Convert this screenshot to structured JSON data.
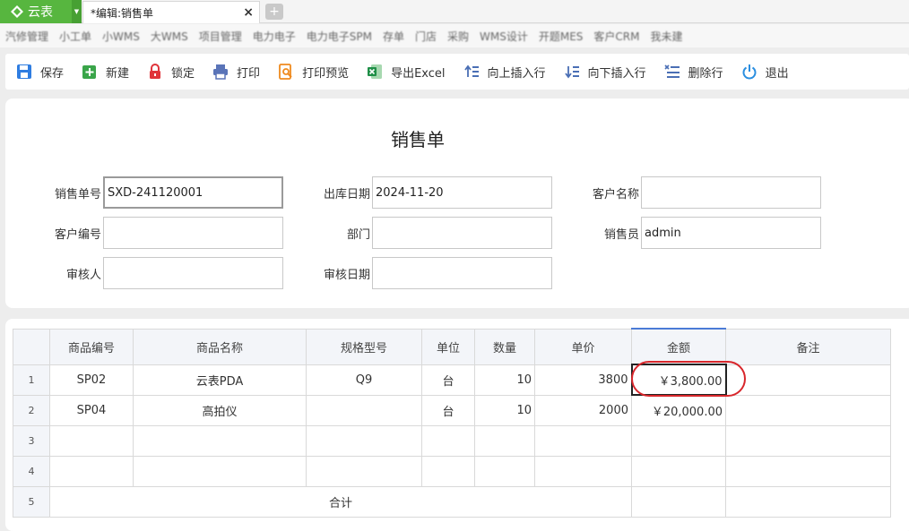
{
  "app": {
    "name": "云表"
  },
  "doc_tab": {
    "title": "*编辑:销售单"
  },
  "bookmarks": [
    "汽修管理",
    "小工单",
    "小WMS",
    "大WMS",
    "项目管理",
    "电力电子",
    "电力电子SPM",
    "存单",
    "门店",
    "采购",
    "WMS设计",
    "开题MES",
    "客户CRM",
    "我未建"
  ],
  "toolbar": {
    "save": "保存",
    "new": "新建",
    "lock": "锁定",
    "print": "打印",
    "print_preview": "打印预览",
    "export_excel": "导出Excel",
    "insert_up": "向上插入行",
    "insert_down": "向下插入行",
    "delete_row": "删除行",
    "exit": "退出"
  },
  "form": {
    "title": "销售单",
    "order_no_label": "销售单号",
    "order_no": "SXD-241120001",
    "ship_date_label": "出库日期",
    "ship_date": "2024-11-20",
    "customer_name_label": "客户名称",
    "customer_name": "",
    "customer_code_label": "客户编号",
    "customer_code": "",
    "department_label": "部门",
    "department": "",
    "salesperson_label": "销售员",
    "salesperson": "admin",
    "reviewer_label": "审核人",
    "reviewer": "",
    "review_date_label": "审核日期",
    "review_date": ""
  },
  "grid": {
    "columns": [
      "商品编号",
      "商品名称",
      "规格型号",
      "单位",
      "数量",
      "单价",
      "金额",
      "备注"
    ],
    "rows": [
      {
        "n": "1",
        "code": "SP02",
        "name": "云表PDA",
        "spec": "Q9",
        "unit": "台",
        "qty": "10",
        "price": "3800",
        "amount": "￥3,800.00",
        "remark": ""
      },
      {
        "n": "2",
        "code": "SP04",
        "name": "高拍仪",
        "spec": "",
        "unit": "台",
        "qty": "10",
        "price": "2000",
        "amount": "￥20,000.00",
        "remark": ""
      },
      {
        "n": "3",
        "code": "",
        "name": "",
        "spec": "",
        "unit": "",
        "qty": "",
        "price": "",
        "amount": "",
        "remark": ""
      },
      {
        "n": "4",
        "code": "",
        "name": "",
        "spec": "",
        "unit": "",
        "qty": "",
        "price": "",
        "amount": "",
        "remark": ""
      }
    ],
    "total_row": {
      "n": "5",
      "label": "合计"
    }
  },
  "colors": {
    "accent": "#57b63f",
    "highlight": "#d8262b",
    "header_bg": "#f3f5f9"
  }
}
